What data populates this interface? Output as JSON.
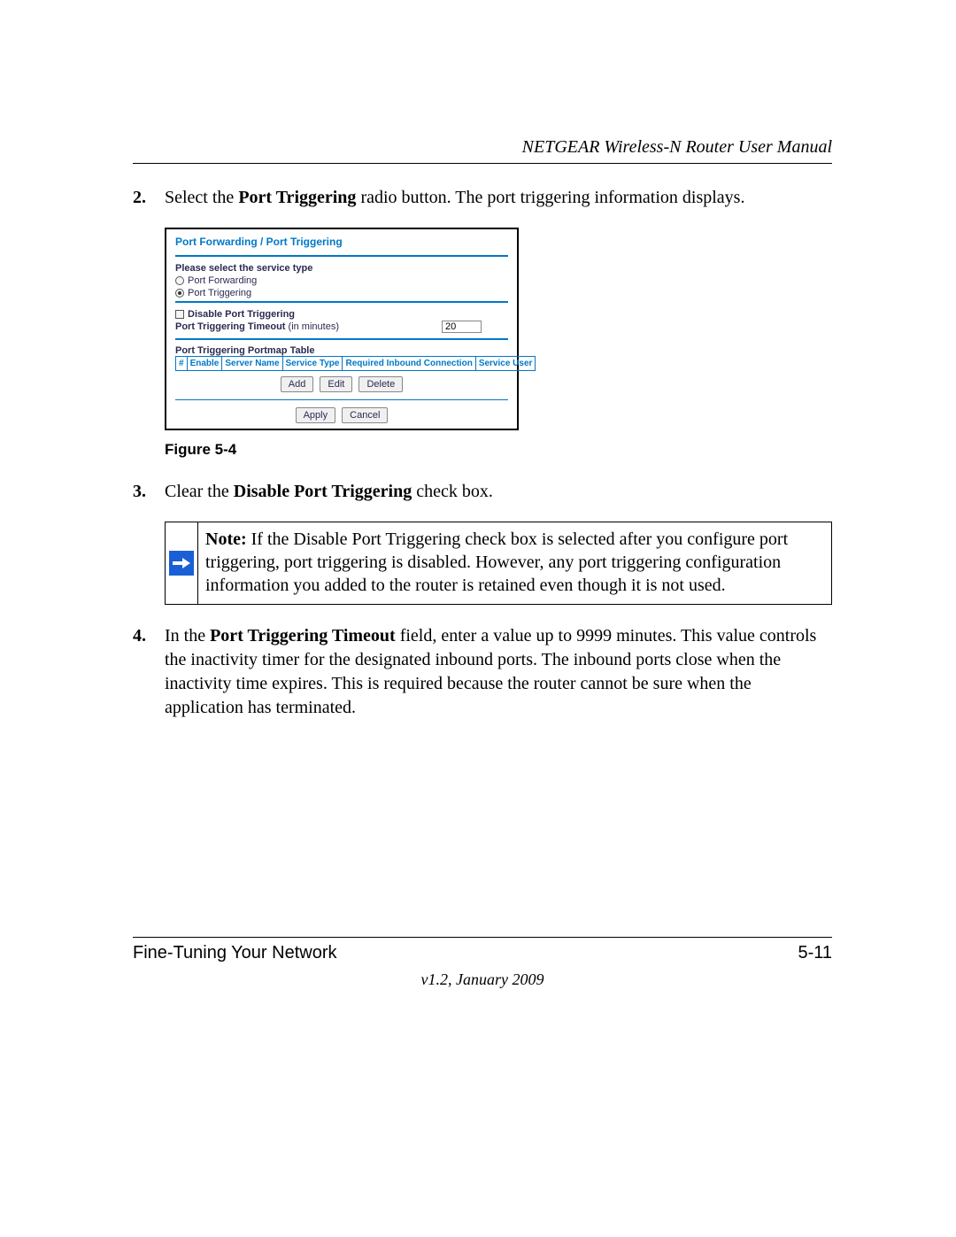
{
  "header": {
    "title": "NETGEAR Wireless-N Router User Manual"
  },
  "steps": {
    "s2": {
      "num": "2.",
      "pre": "Select the ",
      "bold": "Port Triggering",
      "post": " radio button. The port triggering information displays."
    },
    "s3": {
      "num": "3.",
      "pre": "Clear the ",
      "bold": "Disable Port Triggering",
      "post": " check box."
    },
    "s4": {
      "num": "4.",
      "pre": "In the ",
      "bold": "Port Triggering Timeout",
      "post": " field, enter a value up to 9999 minutes. This value controls the inactivity timer for the designated inbound ports. The inbound ports close when the inactivity time expires. This is required because the router cannot be sure when the application has terminated."
    }
  },
  "screenshot": {
    "title": "Port Forwarding / Port Triggering",
    "select_label": "Please select the service type",
    "radio_forwarding": "Port Forwarding",
    "radio_triggering": "Port Triggering",
    "disable_label": "Disable Port Triggering",
    "timeout_label_pre": "Port Triggering Timeout ",
    "timeout_label_post": "(in minutes)",
    "timeout_value": "20",
    "portmap_header": "Port Triggering Portmap Table",
    "cols": {
      "c0": "#",
      "c1": "Enable",
      "c2": "Server Name",
      "c3": "Service Type",
      "c4": "Required Inbound Connection",
      "c5": "Service User"
    },
    "buttons": {
      "add": "Add",
      "edit": "Edit",
      "delete": "Delete",
      "apply": "Apply",
      "cancel": "Cancel"
    }
  },
  "figure_caption": "Figure 5-4",
  "note": {
    "label": "Note:",
    "text": " If the Disable Port Triggering check box is selected after you configure port triggering, port triggering is disabled. However, any port triggering configuration information you added to the router is retained even though it is not used."
  },
  "footer": {
    "section": "Fine-Tuning Your Network",
    "page": "5-11",
    "version": "v1.2, January 2009"
  }
}
